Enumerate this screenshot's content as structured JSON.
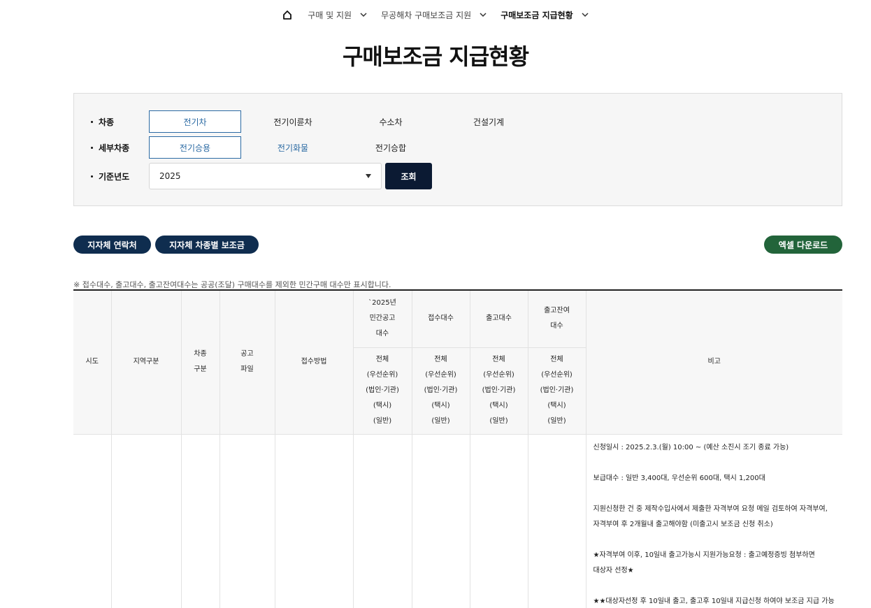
{
  "breadcrumb": {
    "items": [
      {
        "label": "구매 및 지원"
      },
      {
        "label": "무공해차 구매보조금 지원"
      },
      {
        "label": "구매보조금 지급현황"
      }
    ]
  },
  "page_title": "구매보조금 지급현황",
  "filter": {
    "vehicle_type_label": "차종",
    "vehicle_types": [
      "전기차",
      "전기이륜차",
      "수소차",
      "건설기계"
    ],
    "sub_type_label": "세부차종",
    "sub_types": [
      "전기승용",
      "전기화물",
      "전기승합"
    ],
    "year_label": "기준년도",
    "year_value": "2025",
    "search_label": "조회"
  },
  "buttons": {
    "contact": "지자체 연락처",
    "subsidy_by_type": "지자체 차종별 보조금",
    "excel": "엑셀 다운로드"
  },
  "notice": "※ 접수대수, 출고대수, 출고잔여대수는 공공(조달) 구매대수를 제외한 민간구매 대수만 표시합니다.",
  "table": {
    "headers": {
      "sido": "시도",
      "region": "지역구분",
      "car_type_1": "차종",
      "car_type_2": "구분",
      "notice_file_1": "공고",
      "notice_file_2": "파일",
      "method": "접수방법",
      "announce_1": "`2025년",
      "announce_2": "민간공고",
      "announce_3": "대수",
      "received": "접수대수",
      "shipped": "출고대수",
      "remaining_1": "출고잔여",
      "remaining_2": "대수",
      "remarks": "비고"
    },
    "subheads": [
      "전체",
      "(우선순위)",
      "(법인·기관)",
      "(택시)",
      "(일반)"
    ],
    "remarks": [
      "신청일시 : 2025.2.3.(월) 10:00 ~ (예산 소진시 조기 종료 가능)",
      "보급대수 : 일반 3,400대, 우선순위 600대, 택시 1,200대",
      "지원신청한 건 중 제작수입사에서 제출한 자격부여 요청 메일 검토하여 자격부여,",
      "자격부여 후 2개월내 출고해야함 (미출고시 보조금 신청 취소)",
      "★자격부여 이후, 10일내 출고가능시 지원가능요청 : 출고예정증빙 첨부하면",
      "대상자 선정★",
      "★★대상자선정 후 10일내 출고, 출고후 10일내 지급신청 하여야 보조금 지급 가능"
    ]
  }
}
